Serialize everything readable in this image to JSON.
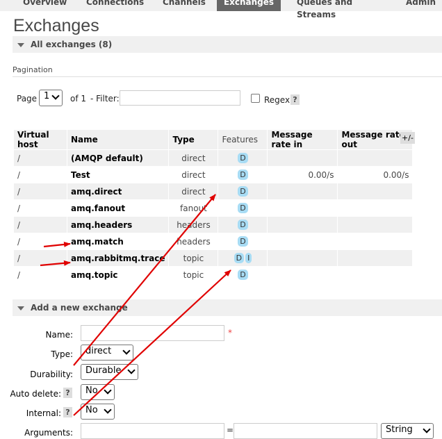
{
  "nav": {
    "tabs": [
      {
        "label": "Overview"
      },
      {
        "label": "Connections"
      },
      {
        "label": "Channels"
      },
      {
        "label": "Exchanges"
      },
      {
        "label": "Queues and Streams"
      },
      {
        "label": "Admin"
      }
    ],
    "active": "Exchanges"
  },
  "page_title": "Exchanges",
  "all_exchanges": {
    "title": "All exchanges (8)"
  },
  "pagination": {
    "label": "Pagination",
    "page_label": "Page",
    "page_value": "1",
    "of_label": "of 1",
    "filter_label": "- Filter:",
    "filter_value": "",
    "regex_label": "Regex",
    "help": "?"
  },
  "table": {
    "headers": [
      "Virtual host",
      "Name",
      "Type",
      "Features",
      "Message rate in",
      "Message rate out"
    ],
    "columns_toggle": "+/-",
    "rows": [
      {
        "vhost": "/",
        "name": "(AMQP default)",
        "type": "direct",
        "features": [
          "D"
        ],
        "rate_in": "",
        "rate_out": ""
      },
      {
        "vhost": "/",
        "name": "Test",
        "type": "direct",
        "features": [
          "D"
        ],
        "rate_in": "0.00/s",
        "rate_out": "0.00/s"
      },
      {
        "vhost": "/",
        "name": "amq.direct",
        "type": "direct",
        "features": [
          "D"
        ],
        "rate_in": "",
        "rate_out": ""
      },
      {
        "vhost": "/",
        "name": "amq.fanout",
        "type": "fanout",
        "features": [
          "D"
        ],
        "rate_in": "",
        "rate_out": ""
      },
      {
        "vhost": "/",
        "name": "amq.headers",
        "type": "headers",
        "features": [
          "D"
        ],
        "rate_in": "",
        "rate_out": ""
      },
      {
        "vhost": "/",
        "name": "amq.match",
        "type": "headers",
        "features": [
          "D"
        ],
        "rate_in": "",
        "rate_out": ""
      },
      {
        "vhost": "/",
        "name": "amq.rabbitmq.trace",
        "type": "topic",
        "features": [
          "D",
          "I"
        ],
        "rate_in": "",
        "rate_out": ""
      },
      {
        "vhost": "/",
        "name": "amq.topic",
        "type": "topic",
        "features": [
          "D"
        ],
        "rate_in": "",
        "rate_out": ""
      }
    ]
  },
  "add_exchange": {
    "title": "Add a new exchange",
    "name_label": "Name:",
    "name_value": "",
    "required_mark": "*",
    "type_label": "Type:",
    "type_value": "direct",
    "durability_label": "Durability:",
    "durability_value": "Durable",
    "auto_delete_label": "Auto delete:",
    "auto_delete_value": "No",
    "internal_label": "Internal:",
    "internal_value": "No",
    "arguments_label": "Arguments:",
    "arguments_eq": "=",
    "arguments_type": "String",
    "help": "?"
  },
  "annotation_colors": {
    "arrow": "#e00000"
  }
}
